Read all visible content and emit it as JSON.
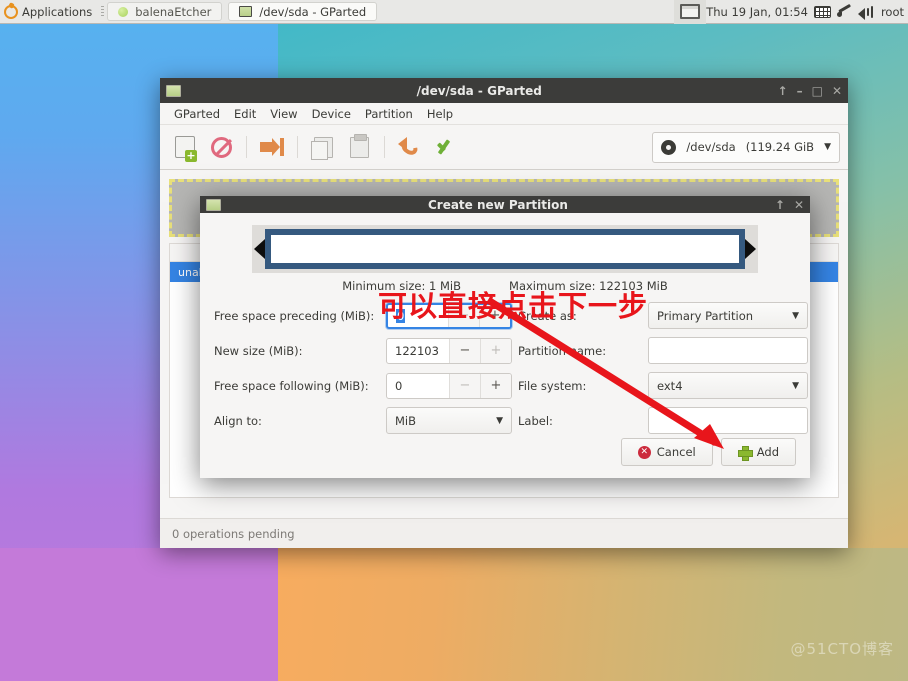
{
  "panel": {
    "applications_label": "Applications",
    "tasks": [
      {
        "label": "balenaEtcher",
        "icon": "green-dot-icon",
        "active": false
      },
      {
        "label": "/dev/sda - GParted",
        "icon": "window-icon",
        "active": true
      }
    ],
    "clock": "Thu 19 Jan, 01:54",
    "user": "root",
    "icons": [
      "keyboard-icon",
      "network-icon",
      "volume-icon"
    ]
  },
  "gparted": {
    "title": "/dev/sda - GParted",
    "menus": [
      "GParted",
      "Edit",
      "View",
      "Device",
      "Partition",
      "Help"
    ],
    "toolbar": [
      "new-partition-icon",
      "delete-partition-icon",
      "resize-move-icon",
      "copy-icon",
      "paste-icon",
      "undo-icon",
      "apply-icon"
    ],
    "device": {
      "name": "/dev/sda",
      "size": "(119.24 GiB"
    },
    "disk_graphic_label": "unallocated",
    "partition_row_label": "unallocated",
    "status": "0 operations pending",
    "window_buttons": [
      "shade",
      "minimize",
      "maximize",
      "close"
    ]
  },
  "dialog": {
    "title": "Create new Partition",
    "window_buttons": [
      "shade",
      "close"
    ],
    "minimum_size": "Minimum size: 1 MiB",
    "maximum_size": "Maximum size: 122103 MiB",
    "fields": {
      "free_preceding_label": "Free space preceding (MiB):",
      "free_preceding_value": "0",
      "new_size_label": "New size (MiB):",
      "new_size_value": "122103",
      "free_following_label": "Free space following (MiB):",
      "free_following_value": "0",
      "align_label": "Align to:",
      "align_value": "MiB",
      "create_as_label": "Create as:",
      "create_as_value": "Primary Partition",
      "partition_name_label": "Partition name:",
      "partition_name_value": "",
      "file_system_label": "File system:",
      "file_system_value": "ext4",
      "partition_label_label": "Label:",
      "partition_label_value": ""
    },
    "buttons": {
      "cancel": "Cancel",
      "add": "Add"
    },
    "spin_minus": "−",
    "spin_plus": "+"
  },
  "annotation": {
    "text": "可以直接点击下一步",
    "color": "#e8151b"
  },
  "watermark": "@51CTO博客",
  "colors": {
    "accent_blue": "#3584e4",
    "titlebar_dark": "#3c3c3a",
    "panel_bg": "#e8e8e6",
    "green": "#8ab82e",
    "red": "#cc2b3d"
  }
}
